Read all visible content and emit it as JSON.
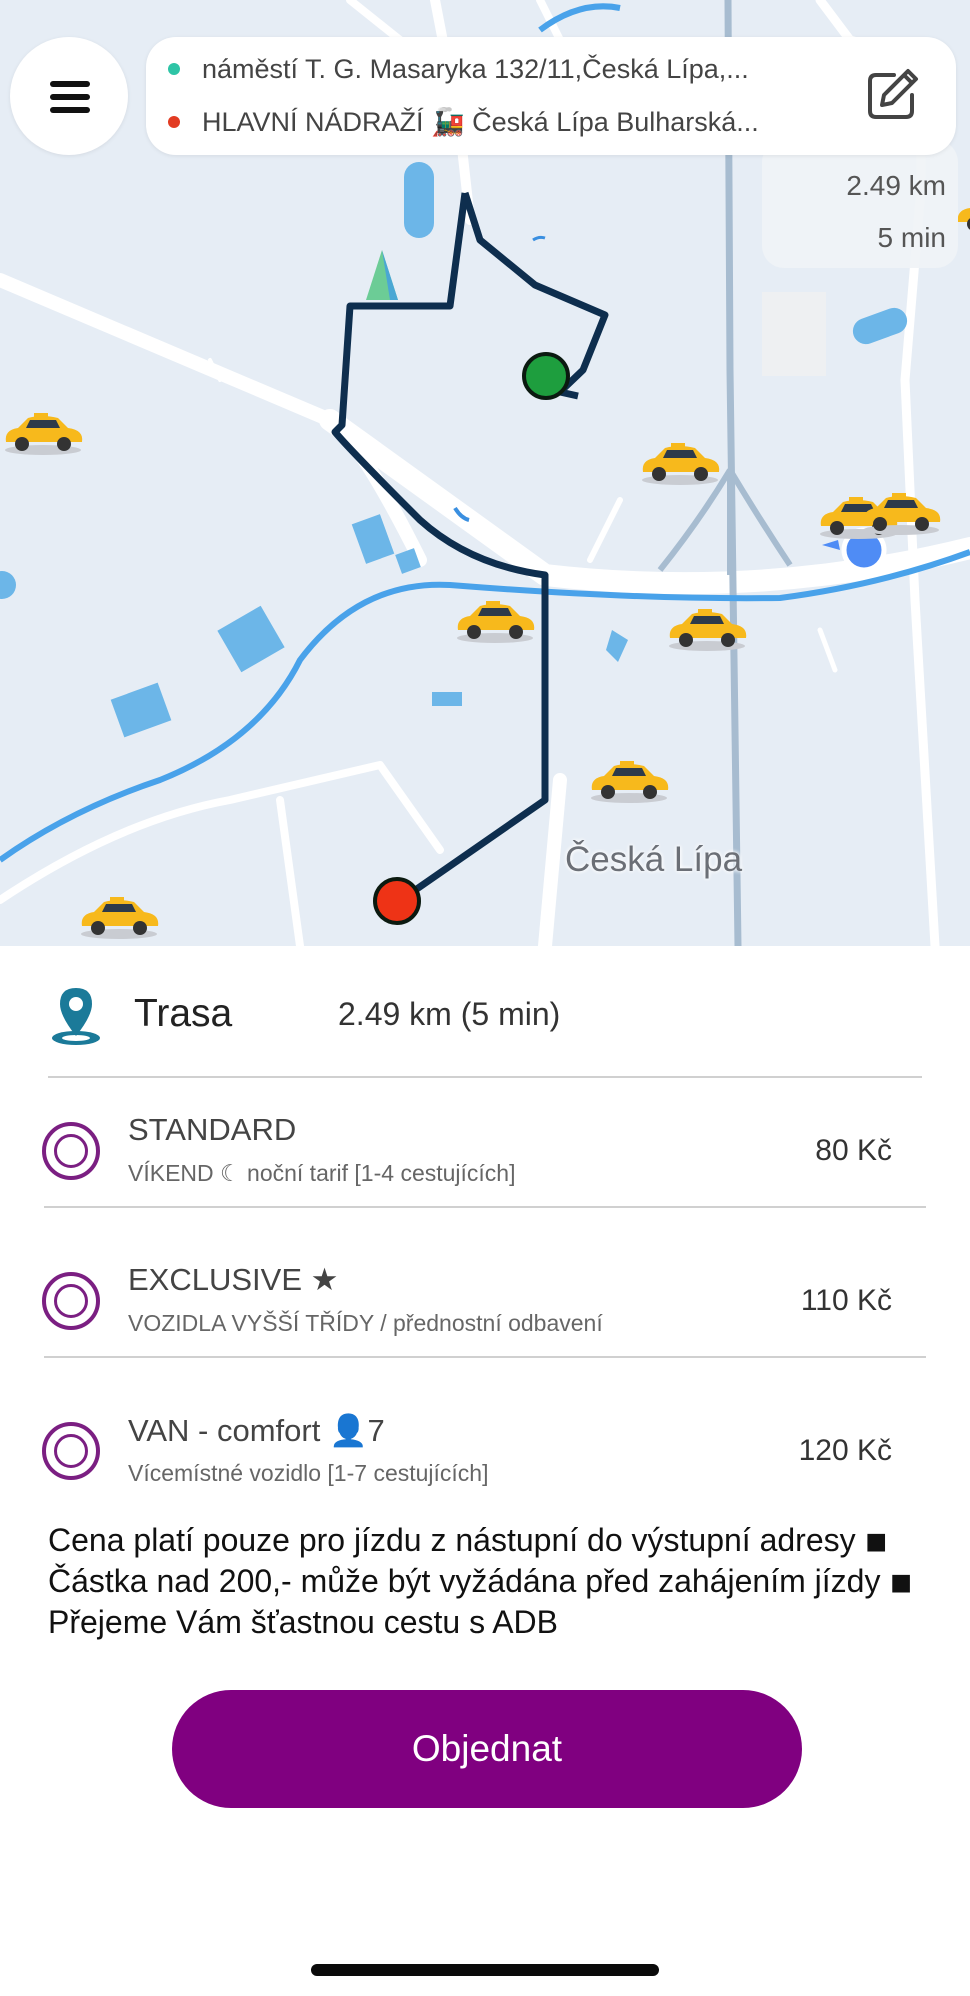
{
  "map": {
    "city_label": "Česká Lípa",
    "route_distance": "2.49 km",
    "route_time": "5 min",
    "start_marker_color": "#1e9e3e",
    "end_marker_color": "#ee3316",
    "route_color": "#0e2e4e"
  },
  "header": {
    "menu_icon": "hamburger-icon",
    "pickup_address": "náměstí T. G. Masaryka 132/11,Česká Lípa,...",
    "pickup_dot_color": "#2ec4a6",
    "destination_address": "HLAVNÍ NÁDRAŽÍ 🚂 Česká Lípa Bulharská...",
    "destination_dot_color": "#e23b22",
    "edit_icon": "edit-icon"
  },
  "route": {
    "icon": "location-pin-icon",
    "label": "Trasa",
    "value": "2.49 km (5 min)"
  },
  "options": [
    {
      "name": "STANDARD",
      "description": "VÍKEND ☾ noční tarif [1-4 cestujících]",
      "price": "80 Kč"
    },
    {
      "name": "EXCLUSIVE ★",
      "description": "VOZIDLA VYŠŠÍ TŘÍDY / přednostní odbavení",
      "price": "110 Kč"
    },
    {
      "name": "VAN - comfort 👤7",
      "description": "Vícemístné vozidlo [1-7 cestujících]",
      "price": "120 Kč"
    }
  ],
  "notice": "Cena platí pouze pro jízdu z nástupní do výstupní adresy ◾ Částka nad 200,- může být vyžádána před zahájením jízdy ◾ Přejeme Vám šťastnou cestu s ADB",
  "order_button": "Objednat",
  "accent_color": "#800080"
}
